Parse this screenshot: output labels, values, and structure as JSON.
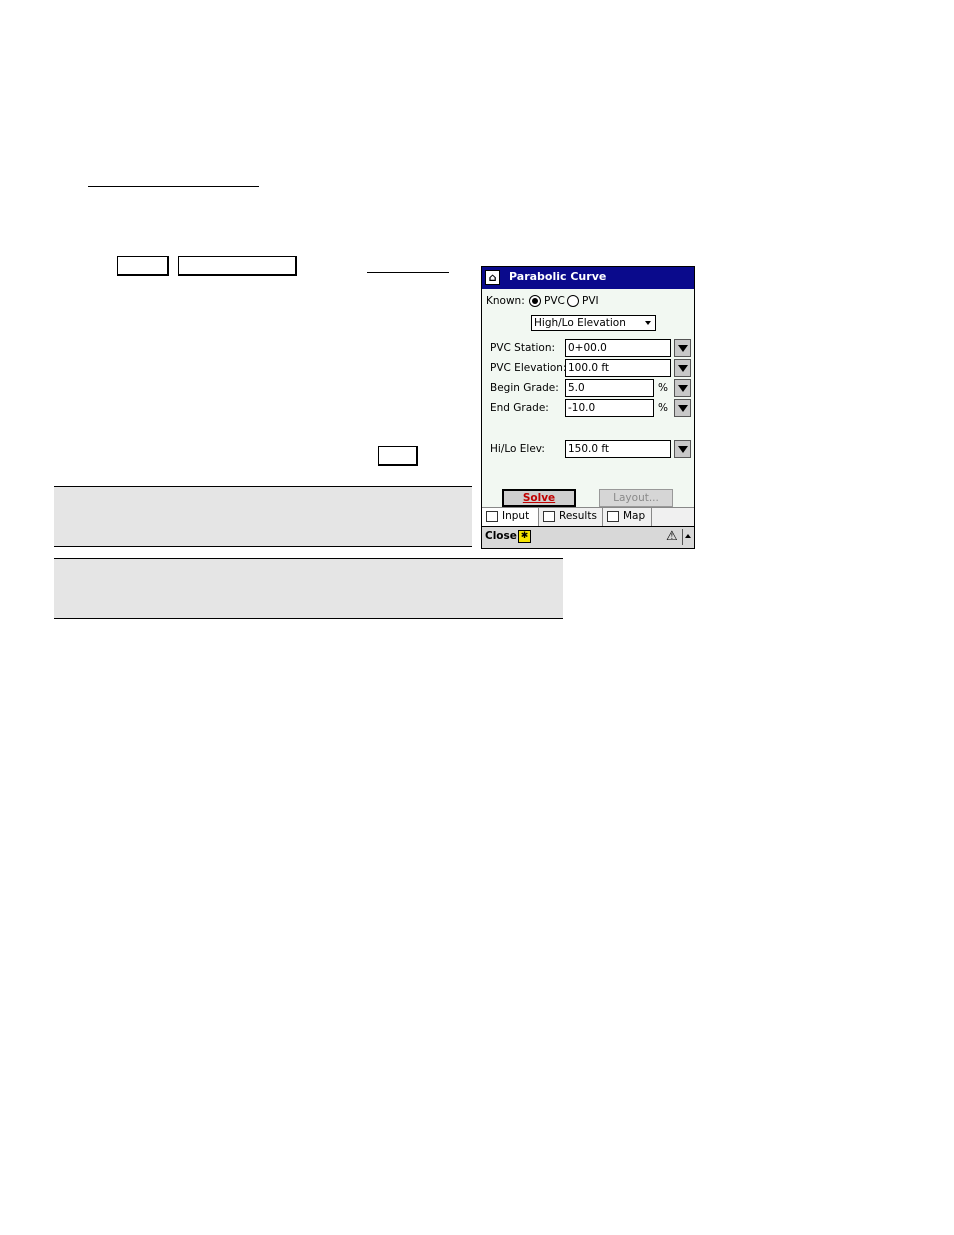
{
  "window": {
    "title": "Parabolic Curve",
    "app_icon": "survey-app-icon"
  },
  "form": {
    "known_label": "Known:",
    "known_options": [
      "PVC",
      "PVI"
    ],
    "known_selected": "PVC",
    "mode_select": "High/Lo Elevation",
    "fields": [
      {
        "label": "PVC Station:",
        "value": "0+00.0",
        "unit": ""
      },
      {
        "label": "PVC Elevation:",
        "value": "100.0 ft",
        "unit": ""
      },
      {
        "label": "Begin Grade:",
        "value": "5.0",
        "unit": "%"
      },
      {
        "label": "End Grade:",
        "value": "-10.0",
        "unit": "%"
      }
    ],
    "hilo": {
      "label": "Hi/Lo Elev:",
      "value": "150.0 ft"
    },
    "solve_label": "Solve",
    "layout_label": "Layout..."
  },
  "tabs": [
    {
      "label": "Input",
      "icon": "input-tab-icon",
      "active": true
    },
    {
      "label": "Results",
      "icon": "results-tab-icon",
      "active": false
    },
    {
      "label": "Map",
      "icon": "map-tab-icon",
      "active": false
    }
  ],
  "command_bar": {
    "close_label": "Close",
    "star_icon": "star-icon",
    "warning_icon": "warning-icon"
  }
}
